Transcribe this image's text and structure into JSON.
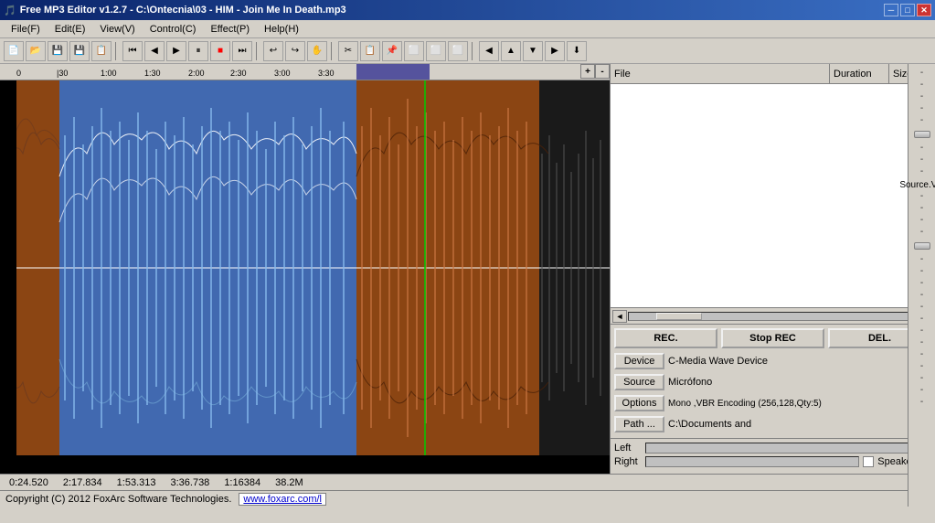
{
  "window": {
    "title": "Free MP3 Editor v1.2.7 - C:\\Ontecnia\\03 - HIM - Join Me In Death.mp3",
    "icon": "♪"
  },
  "titlebar_controls": {
    "minimize": "─",
    "maximize": "□",
    "close": "✕"
  },
  "menu": {
    "items": [
      {
        "label": "File(F)",
        "id": "file"
      },
      {
        "label": "Edit(E)",
        "id": "edit"
      },
      {
        "label": "View(V)",
        "id": "view"
      },
      {
        "label": "Control(C)",
        "id": "control"
      },
      {
        "label": "Effect(P)",
        "id": "effect"
      },
      {
        "label": "Help(H)",
        "id": "help"
      }
    ]
  },
  "timeline": {
    "marks": [
      "0",
      "|30",
      "1:00",
      "1:30",
      "2:00",
      "2:30",
      "3:00",
      "3:30"
    ],
    "zoom_plus": "+",
    "zoom_minus": "-"
  },
  "file_list": {
    "columns": [
      "File",
      "Duration",
      "Size"
    ]
  },
  "scrollbar": {
    "left_arrow": "◄",
    "right_arrow": "►"
  },
  "rec_controls": {
    "rec_label": "REC.",
    "stop_label": "Stop REC",
    "del_label": "DEL.",
    "device_btn": "Device",
    "device_value": "C-Media Wave Device",
    "source_btn": "Source",
    "source_value": "Micrófono",
    "options_btn": "Options",
    "options_value": "Mono ,VBR Encoding  (256,128,Qty:5)",
    "path_btn": "Path ...",
    "path_value": "C:\\Documents and"
  },
  "levels": {
    "left_label": "Left",
    "right_label": "Right",
    "speaker_label": "Speaker.Vol"
  },
  "volume": {
    "source_vol_label": "Source.Vol",
    "dashes": [
      "-",
      "-",
      "-",
      "-",
      "-",
      "-",
      "-",
      "-",
      "-",
      "-",
      "-",
      "-",
      "-",
      "-",
      "-"
    ]
  },
  "status": {
    "time1": "0:24.520",
    "time2": "2:17.834",
    "time3": "1:53.313",
    "time4": "3:36.738",
    "time5": "1:16384",
    "size": "38.2M",
    "copyright": "Copyright (C) 2012 FoxArc Software Technologies.",
    "website": "www.foxarc.com/l"
  }
}
